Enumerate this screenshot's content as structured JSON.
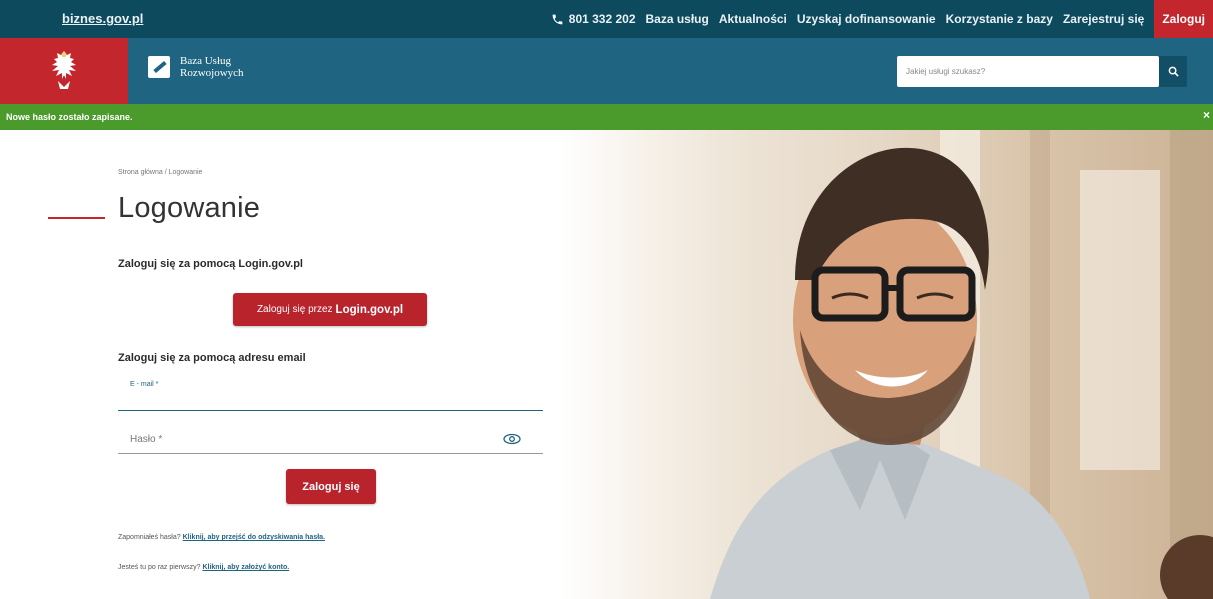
{
  "topbar": {
    "site_link": "biznes.gov.pl",
    "phone": "801 332 202",
    "nav": [
      "Baza usług",
      "Aktualności",
      "Uzyskaj dofinansowanie",
      "Korzystanie z bazy",
      "Zarejestruj się"
    ],
    "login": "Zaloguj"
  },
  "header": {
    "logo_line1": "Baza Usług",
    "logo_line2": "Rozwojowych",
    "search_placeholder": "Jakiej usługi szukasz?"
  },
  "banner": {
    "message": "Nowe hasło zostało zapisane.",
    "close": "×"
  },
  "breadcrumb": "Strona główna / Logowanie",
  "title": "Logowanie",
  "gov_section": {
    "label": "Zaloguj się za pomocą Login.gov.pl",
    "button_prefix": "Zaloguj się przez",
    "button_bold": "Login.gov.pl"
  },
  "email_section": {
    "label": "Zaloguj się za pomocą adresu email",
    "email_label": "E - mail *",
    "password_label": "Hasło *",
    "submit": "Zaloguj się"
  },
  "footer": {
    "forgot_prefix": "Zapomniałeś hasła?",
    "forgot_link": "Kliknij, aby przejść do odzyskiwania hasła.",
    "first_prefix": "Jesteś tu po raz pierwszy?",
    "first_link": "Kliknij, aby założyć konto."
  },
  "colors": {
    "topbar": "#0e4a5e",
    "header": "#1f6480",
    "accent_red": "#c4262e",
    "banner_green": "#4b9a2c"
  },
  "icons": [
    "phone-icon",
    "eagle-emblem-icon",
    "bur-logo-icon",
    "search-icon",
    "eye-icon",
    "close-icon"
  ]
}
